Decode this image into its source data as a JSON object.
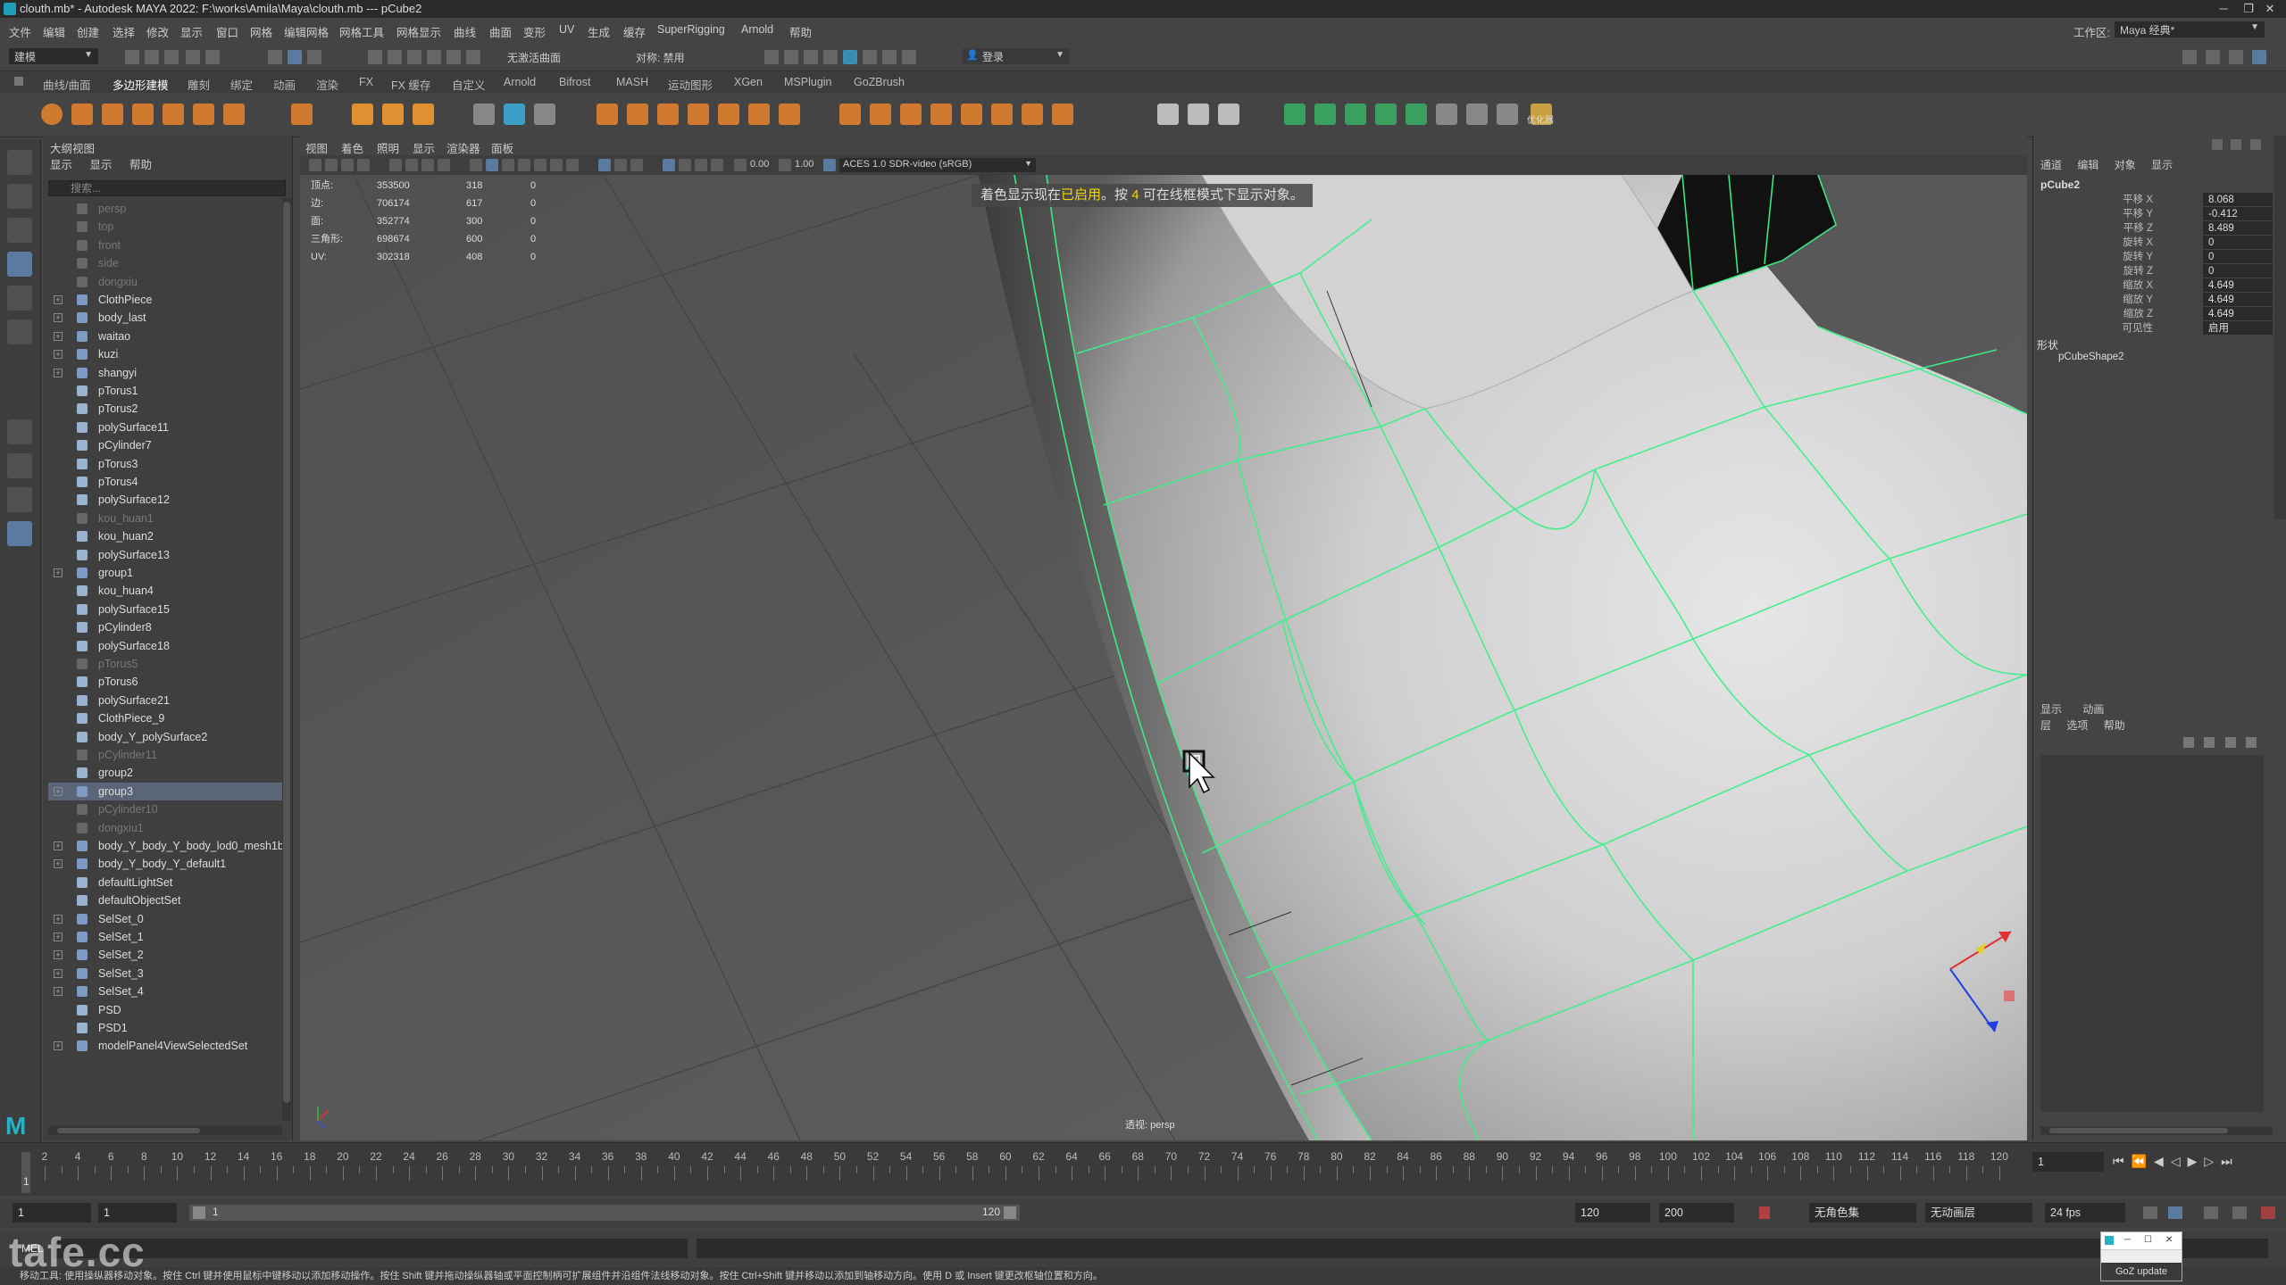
{
  "window": {
    "title": "clouth.mb* - Autodesk MAYA 2022: F:\\works\\Amila\\Maya\\clouth.mb   ---   pCube2"
  },
  "menubar": {
    "items": [
      "文件",
      "编辑",
      "创建",
      "选择",
      "修改",
      "显示",
      "窗口",
      "网格",
      "编辑网格",
      "网格工具",
      "网格显示",
      "曲线",
      "曲面",
      "变形",
      "UV",
      "生成",
      "缓存",
      "SuperRigging",
      "Arnold",
      "帮助"
    ],
    "workspace_label": "工作区:",
    "workspace_value": "Maya 经典*"
  },
  "statusline": {
    "mode": "建模",
    "symmetry": "对称: 禁用",
    "live_surface": "无激活曲面",
    "login": "登录"
  },
  "shelf_tabs": [
    "曲线/曲面",
    "多边形建模",
    "雕刻",
    "绑定",
    "动画",
    "渲染",
    "FX",
    "FX 缓存",
    "自定义",
    "Arnold",
    "Bifrost",
    "MASH",
    "运动图形",
    "XGen",
    "MSPlugin",
    "GoZBrush"
  ],
  "shelf_last_label": "优化器",
  "outliner": {
    "title": "大纲视图",
    "menus": [
      "显示",
      "显示",
      "帮助"
    ],
    "search_placeholder": "搜索...",
    "items": [
      {
        "label": "persp",
        "dim": true,
        "exp": false
      },
      {
        "label": "top",
        "dim": true,
        "exp": false
      },
      {
        "label": "front",
        "dim": true,
        "exp": false
      },
      {
        "label": "side",
        "dim": true,
        "exp": false
      },
      {
        "label": "dongxiu",
        "dim": true,
        "exp": false
      },
      {
        "label": "ClothPiece",
        "dim": false,
        "exp": true
      },
      {
        "label": "body_last",
        "dim": false,
        "exp": true
      },
      {
        "label": "waitao",
        "dim": false,
        "exp": true
      },
      {
        "label": "kuzi",
        "dim": false,
        "exp": true
      },
      {
        "label": "shangyi",
        "dim": false,
        "exp": true
      },
      {
        "label": "pTorus1",
        "dim": false,
        "exp": false
      },
      {
        "label": "pTorus2",
        "dim": false,
        "exp": false
      },
      {
        "label": "polySurface11",
        "dim": false,
        "exp": false
      },
      {
        "label": "pCylinder7",
        "dim": false,
        "exp": false
      },
      {
        "label": "pTorus3",
        "dim": false,
        "exp": false
      },
      {
        "label": "pTorus4",
        "dim": false,
        "exp": false
      },
      {
        "label": "polySurface12",
        "dim": false,
        "exp": false
      },
      {
        "label": "kou_huan1",
        "dim": true,
        "exp": false
      },
      {
        "label": "kou_huan2",
        "dim": false,
        "exp": false
      },
      {
        "label": "polySurface13",
        "dim": false,
        "exp": false
      },
      {
        "label": "group1",
        "dim": false,
        "exp": true
      },
      {
        "label": "kou_huan4",
        "dim": false,
        "exp": false
      },
      {
        "label": "polySurface15",
        "dim": false,
        "exp": false
      },
      {
        "label": "pCylinder8",
        "dim": false,
        "exp": false
      },
      {
        "label": "polySurface18",
        "dim": false,
        "exp": false
      },
      {
        "label": "pTorus5",
        "dim": true,
        "exp": false
      },
      {
        "label": "pTorus6",
        "dim": false,
        "exp": false
      },
      {
        "label": "polySurface21",
        "dim": false,
        "exp": false
      },
      {
        "label": "ClothPiece_9",
        "dim": false,
        "exp": false
      },
      {
        "label": "body_Y_polySurface2",
        "dim": false,
        "exp": false
      },
      {
        "label": "pCylinder11",
        "dim": true,
        "exp": false
      },
      {
        "label": "group2",
        "dim": false,
        "exp": false
      },
      {
        "label": "group3",
        "dim": false,
        "exp": true,
        "selected": true
      },
      {
        "label": "pCylinder10",
        "dim": true,
        "exp": false
      },
      {
        "label": "dongxiu1",
        "dim": true,
        "exp": false
      },
      {
        "label": "body_Y_body_Y_body_lod0_mesh1b",
        "dim": false,
        "exp": true
      },
      {
        "label": "body_Y_body_Y_default1",
        "dim": false,
        "exp": true
      },
      {
        "label": "defaultLightSet",
        "dim": false,
        "exp": false
      },
      {
        "label": "defaultObjectSet",
        "dim": false,
        "exp": false
      },
      {
        "label": "SelSet_0",
        "dim": false,
        "exp": true
      },
      {
        "label": "SelSet_1",
        "dim": false,
        "exp": true
      },
      {
        "label": "SelSet_2",
        "dim": false,
        "exp": true
      },
      {
        "label": "SelSet_3",
        "dim": false,
        "exp": true
      },
      {
        "label": "SelSet_4",
        "dim": false,
        "exp": true
      },
      {
        "label": "PSD",
        "dim": false,
        "exp": false
      },
      {
        "label": "PSD1",
        "dim": false,
        "exp": false
      },
      {
        "label": "modelPanel4ViewSelectedSet",
        "dim": false,
        "exp": true
      }
    ]
  },
  "viewport": {
    "menus": [
      "视图",
      "着色",
      "照明",
      "显示",
      "渲染器",
      "面板"
    ],
    "gamma_value": "0.00",
    "exposure_value": "1.00",
    "colorspace": "ACES 1.0 SDR-video (sRGB)",
    "hud": [
      {
        "label": "顶点:",
        "a": "353500",
        "b": "318",
        "c": "0"
      },
      {
        "label": "边:",
        "a": "706174",
        "b": "617",
        "c": "0"
      },
      {
        "label": "面:",
        "a": "352774",
        "b": "300",
        "c": "0"
      },
      {
        "label": "三角形:",
        "a": "698674",
        "b": "600",
        "c": "0"
      },
      {
        "label": "UV:",
        "a": "302318",
        "b": "408",
        "c": "0"
      }
    ],
    "notice_prefix": "着色显示现在",
    "notice_enabled": "已启用",
    "notice_mid": "。按",
    "notice_key": "4",
    "notice_suffix": "可在线框模式下显示对象。",
    "camera_label": "透视: persp"
  },
  "channel_box": {
    "tabs": [
      "通道",
      "编辑",
      "对象",
      "显示"
    ],
    "object_name": "pCube2",
    "attributes": [
      {
        "name": "平移 X",
        "value": "8.068"
      },
      {
        "name": "平移 Y",
        "value": "-0.412"
      },
      {
        "name": "平移 Z",
        "value": "8.489"
      },
      {
        "name": "旋转 X",
        "value": "0"
      },
      {
        "name": "旋转 Y",
        "value": "0"
      },
      {
        "name": "旋转 Z",
        "value": "0"
      },
      {
        "name": "缩放 X",
        "value": "4.649"
      },
      {
        "name": "缩放 Y",
        "value": "4.649"
      },
      {
        "name": "缩放 Z",
        "value": "4.649"
      },
      {
        "name": "可见性",
        "value": "启用"
      }
    ],
    "shapes_label": "形状",
    "shape_name": "pCubeShape2"
  },
  "layer_editor": {
    "tabs": [
      "显示",
      "动画"
    ],
    "menus": [
      "层",
      "选项",
      "帮助"
    ]
  },
  "timeslider": {
    "ticks": [
      "2",
      "4",
      "6",
      "8",
      "10",
      "12",
      "14",
      "16",
      "18",
      "20",
      "22",
      "24",
      "26",
      "28",
      "30",
      "32",
      "34",
      "36",
      "38",
      "40",
      "42",
      "44",
      "46",
      "48",
      "50",
      "52",
      "54",
      "56",
      "58",
      "60",
      "62",
      "64",
      "66",
      "68",
      "70",
      "72",
      "74",
      "76",
      "78",
      "80",
      "82",
      "84",
      "86",
      "88",
      "90",
      "92",
      "94",
      "96",
      "98",
      "100",
      "102",
      "104",
      "106",
      "108",
      "110",
      "112",
      "114",
      "116",
      "118",
      "120"
    ],
    "current_frame": "1",
    "current_frame_field": "1"
  },
  "range": {
    "start": "1",
    "start2": "1",
    "range_start_label": "1",
    "range_end_label": "120",
    "end": "120",
    "end2": "200",
    "char_set": "无角色集",
    "anim_layer": "无动画层",
    "fps": "24 fps"
  },
  "cmdline": {
    "label": "MEL"
  },
  "helpline": {
    "text": "移动工具: 使用操纵器移动对象。按住 Ctrl 键并使用鼠标中键移动以添加移动操作。按住 Shift 键并拖动操纵器轴或平面控制柄可扩展组件并沿组件法线移动对象。按住 Ctrl+Shift 键并移动以添加到轴移动方向。使用 D 或 Insert 键更改枢轴位置和方向。"
  },
  "watermark": {
    "text": "tafe.cc"
  },
  "goz": {
    "label": "GoZ update"
  }
}
